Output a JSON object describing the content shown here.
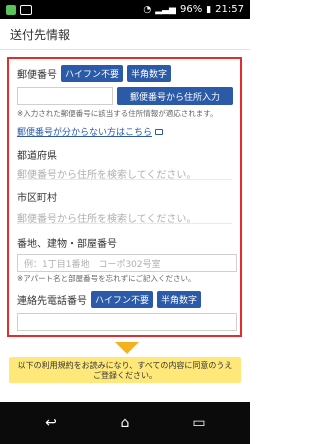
{
  "statusbar": {
    "battery_pct": "96%",
    "time": "21:57"
  },
  "header": {
    "title": "送付先情報"
  },
  "postal": {
    "label": "郵便番号",
    "badges": [
      "ハイフン不要",
      "半角数字"
    ],
    "button_label": "郵便番号から住所入力",
    "note": "※入力された郵便番号に該当する住所情報が適応されます。",
    "help_link": "郵便番号が分からない方はこちら"
  },
  "prefecture": {
    "label": "都道府県",
    "placeholder": "郵便番号から住所を検索してください。"
  },
  "city": {
    "label": "市区町村",
    "placeholder": "郵便番号から住所を検索してください。"
  },
  "address": {
    "label": "番地、建物・部屋番号",
    "placeholder": "例：1丁目1番地　コーポ302号室",
    "note": "※アパート名と部屋番号を忘れずにご記入ください。"
  },
  "phone": {
    "label": "連絡先電話番号",
    "badges": [
      "ハイフン不要",
      "半角数字"
    ]
  },
  "bottom_bar": {
    "text": "以下の利用規約をお読みになり、すべての内容に同意のうえご登録ください。"
  },
  "colors": {
    "panel_border": "#e52b2b",
    "badge_bg": "#2b5aa8",
    "arrow": "#f5b21f",
    "info_bar_bg": "#ffe87a"
  },
  "nav": {
    "icons": [
      "back-icon",
      "home-icon",
      "recents-icon"
    ]
  }
}
